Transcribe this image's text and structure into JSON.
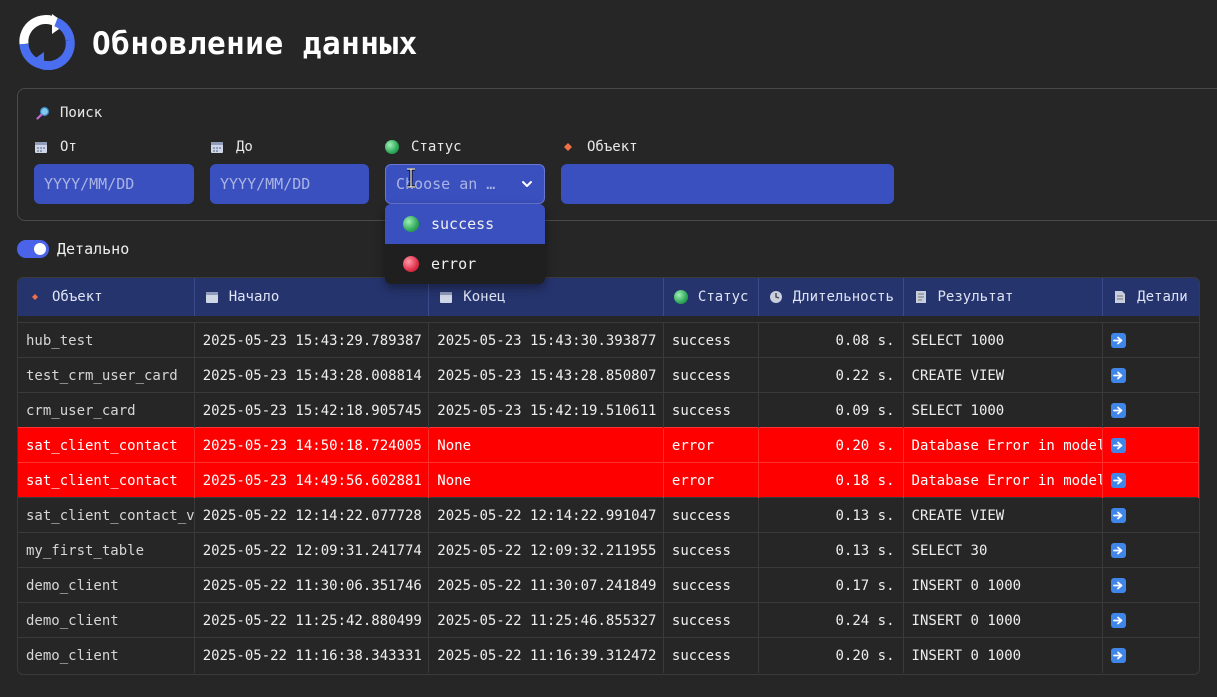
{
  "page": {
    "title": "Обновление данных",
    "accent_color": "#3b50bf"
  },
  "search": {
    "label": "Поиск",
    "from": {
      "label": "От",
      "placeholder": "YYYY/MM/DD",
      "icon": "calendar-icon"
    },
    "to": {
      "label": "До",
      "placeholder": "YYYY/MM/DD",
      "icon": "calendar-icon"
    },
    "status": {
      "label": "Статус",
      "placeholder": "Choose an …",
      "icon": "green-circle-icon"
    },
    "object": {
      "label": "Объект",
      "value": "",
      "icon": "diamond-icon"
    }
  },
  "status_dropdown": {
    "options": [
      {
        "label": "success",
        "icon": "green-circle-icon",
        "highlighted": true
      },
      {
        "label": "error",
        "icon": "red-circle-icon",
        "highlighted": false
      }
    ]
  },
  "detail_toggle": {
    "label": "Детально",
    "on": true
  },
  "table": {
    "columns": [
      {
        "label": "Объект",
        "icon": "diamond-icon"
      },
      {
        "label": "Начало",
        "icon": "calendar-icon"
      },
      {
        "label": "Конец",
        "icon": "calendar-icon"
      },
      {
        "label": "Статус",
        "icon": "green-circle-icon"
      },
      {
        "label": "Длительность",
        "icon": "clock-icon"
      },
      {
        "label": "Результат",
        "icon": "document-icon"
      },
      {
        "label": "Детали",
        "icon": "page-icon"
      }
    ],
    "rows": [
      {
        "object": "hub_test",
        "start": "2025-05-23 15:43:29.789387",
        "end": "2025-05-23 15:43:30.393877",
        "status": "success",
        "duration": "0.08 s.",
        "result": "SELECT 1000"
      },
      {
        "object": "test_crm_user_card",
        "start": "2025-05-23 15:43:28.008814",
        "end": "2025-05-23 15:43:28.850807",
        "status": "success",
        "duration": "0.22 s.",
        "result": "CREATE VIEW"
      },
      {
        "object": "crm_user_card",
        "start": "2025-05-23 15:42:18.905745",
        "end": "2025-05-23 15:42:19.510611",
        "status": "success",
        "duration": "0.09 s.",
        "result": "SELECT 1000"
      },
      {
        "object": "sat_client_contact",
        "start": "2025-05-23 14:50:18.724005",
        "end": "None",
        "status": "error",
        "duration": "0.20 s.",
        "result": "Database Error in model"
      },
      {
        "object": "sat_client_contact",
        "start": "2025-05-23 14:49:56.602881",
        "end": "None",
        "status": "error",
        "duration": "0.18 s.",
        "result": "Database Error in model"
      },
      {
        "object": "sat_client_contact_v",
        "start": "2025-05-22 12:14:22.077728",
        "end": "2025-05-22 12:14:22.991047",
        "status": "success",
        "duration": "0.13 s.",
        "result": "CREATE VIEW"
      },
      {
        "object": "my_first_table",
        "start": "2025-05-22 12:09:31.241774",
        "end": "2025-05-22 12:09:32.211955",
        "status": "success",
        "duration": "0.13 s.",
        "result": "SELECT 30"
      },
      {
        "object": "demo_client",
        "start": "2025-05-22 11:30:06.351746",
        "end": "2025-05-22 11:30:07.241849",
        "status": "success",
        "duration": "0.17 s.",
        "result": "INSERT 0 1000"
      },
      {
        "object": "demo_client",
        "start": "2025-05-22 11:25:42.880499",
        "end": "2025-05-22 11:25:46.855327",
        "status": "success",
        "duration": "0.24 s.",
        "result": "INSERT 0 1000"
      },
      {
        "object": "demo_client",
        "start": "2025-05-22 11:16:38.343331",
        "end": "2025-05-22 11:16:39.312472",
        "status": "success",
        "duration": "0.20 s.",
        "result": "INSERT 0 1000"
      }
    ]
  }
}
